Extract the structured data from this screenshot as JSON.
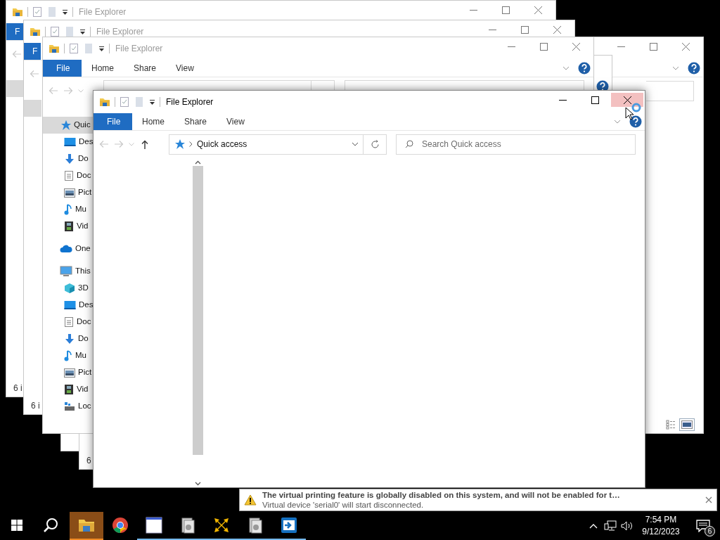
{
  "windows": [
    {
      "active": false,
      "title": "File Explorer",
      "controls": [
        {
          "kind": "minimize",
          "hovered": false
        },
        {
          "kind": "maximize",
          "hovered": false
        },
        {
          "kind": "close",
          "hovered": false
        }
      ],
      "ribbon_tabs": [
        {
          "label": "F",
          "kind": "partial"
        }
      ],
      "nav_buttons": [
        {
          "kind": "back",
          "disabled": true
        }
      ],
      "nav_selected": true,
      "status": "6 i"
    },
    {
      "active": false,
      "title": "File Explorer",
      "controls": [
        {
          "kind": "minimize",
          "hovered": false
        },
        {
          "kind": "maximize",
          "hovered": false
        },
        {
          "kind": "close",
          "hovered": false
        }
      ],
      "ribbon_tabs": [
        {
          "label": "F",
          "kind": "partial"
        }
      ],
      "nav_buttons": [
        {
          "kind": "back",
          "disabled": true
        }
      ],
      "nav_selected": true,
      "status": "6 i"
    },
    {
      "controls": [
        {
          "kind": "minimize",
          "hovered": false
        },
        {
          "kind": "maximize",
          "hovered": false
        },
        {
          "kind": "close",
          "hovered": false
        }
      ],
      "ribbon_chevron": true,
      "ribbon_help": true,
      "search_field": true,
      "view_buttons": [
        {
          "kind": "details",
          "selected": false
        },
        {
          "kind": "large-icons",
          "selected": true
        }
      ]
    },
    {
      "ribbon_help": true
    },
    {
      "status": "6"
    },
    {
      "active": false,
      "title": "File Explorer",
      "controls": [
        {
          "kind": "minimize",
          "hovered": false
        },
        {
          "kind": "maximize",
          "hovered": false
        },
        {
          "kind": "close",
          "hovered": false
        }
      ],
      "ribbon_tabs": [
        {
          "label": "File",
          "kind": "file"
        },
        {
          "label": "Home",
          "kind": "tab"
        },
        {
          "label": "Share",
          "kind": "tab"
        },
        {
          "label": "View",
          "kind": "tab"
        }
      ],
      "ribbon_chevron": true,
      "ribbon_help": true,
      "nav_buttons": [
        {
          "kind": "back",
          "disabled": true
        },
        {
          "kind": "forward",
          "disabled": true
        },
        {
          "kind": "recent",
          "disabled": true
        }
      ],
      "address_strip": true,
      "nav_items": [
        {
          "kind": "quick",
          "label": "Quic",
          "selected": true,
          "children": [
            {
              "kind": "desktop",
              "label": "Des",
              "selected": false
            },
            {
              "kind": "downloads",
              "label": "Do",
              "selected": false
            },
            {
              "kind": "documents",
              "label": "Doc",
              "selected": false
            },
            {
              "kind": "pictures",
              "label": "Pict",
              "selected": false
            },
            {
              "kind": "music",
              "label": "Mu",
              "selected": false
            },
            {
              "kind": "videos",
              "label": "Vid",
              "selected": false
            }
          ]
        },
        {
          "kind": "onedrive",
          "label": "One",
          "selected": false
        },
        {
          "kind": "pc",
          "label": "This",
          "selected": false,
          "children": [
            {
              "kind": "objects",
              "label": "3D",
              "selected": false
            },
            {
              "kind": "desktop",
              "label": "Des",
              "selected": false
            },
            {
              "kind": "documents",
              "label": "Doc",
              "selected": false
            },
            {
              "kind": "downloads",
              "label": "Do",
              "selected": false
            },
            {
              "kind": "music",
              "label": "Mu",
              "selected": false
            },
            {
              "kind": "pictures",
              "label": "Pict",
              "selected": false
            },
            {
              "kind": "videos",
              "label": "Vid",
              "selected": false
            },
            {
              "kind": "drive",
              "label": "Loc",
              "selected": false
            }
          ]
        }
      ]
    },
    {
      "active": true,
      "title": "File Explorer",
      "controls": [
        {
          "kind": "minimize",
          "hovered": false
        },
        {
          "kind": "maximize",
          "hovered": false
        },
        {
          "kind": "close",
          "hovered": true
        }
      ],
      "ribbon_tabs": [
        {
          "label": "File",
          "kind": "file"
        },
        {
          "label": "Home",
          "kind": "tab"
        },
        {
          "label": "Share",
          "kind": "tab"
        },
        {
          "label": "View",
          "kind": "tab"
        }
      ],
      "ribbon_chevron": true,
      "ribbon_help": true,
      "nav_buttons": [
        {
          "kind": "back",
          "disabled": true
        },
        {
          "kind": "forward",
          "disabled": true
        },
        {
          "kind": "recent",
          "disabled": true
        },
        {
          "kind": "up",
          "disabled": false
        }
      ],
      "address": "Quick access",
      "search": {
        "placeholder": "Search Quick access"
      },
      "nav_scrollbar": true
    }
  ],
  "notification": {
    "title": "The virtual printing feature is globally disabled on this system, and will not be enabled for t…",
    "message": "Virtual device 'serial0' will start disconnected."
  },
  "taskbar": {
    "items": [
      {
        "kind": "start",
        "running": false,
        "active": false
      },
      {
        "kind": "search",
        "running": false,
        "active": false
      },
      {
        "kind": "explorer",
        "running": true,
        "active": true
      },
      {
        "kind": "chrome",
        "running": false,
        "active": false
      },
      {
        "kind": "window",
        "running": true,
        "active": false
      },
      {
        "kind": "app",
        "running": true,
        "active": false
      },
      {
        "kind": "arrows",
        "running": true,
        "active": false
      },
      {
        "kind": "app",
        "running": true,
        "active": false
      },
      {
        "kind": "remote",
        "running": true,
        "active": false
      }
    ],
    "time": "7:54 PM",
    "date": "9/12/2023",
    "notification_count": "6"
  }
}
